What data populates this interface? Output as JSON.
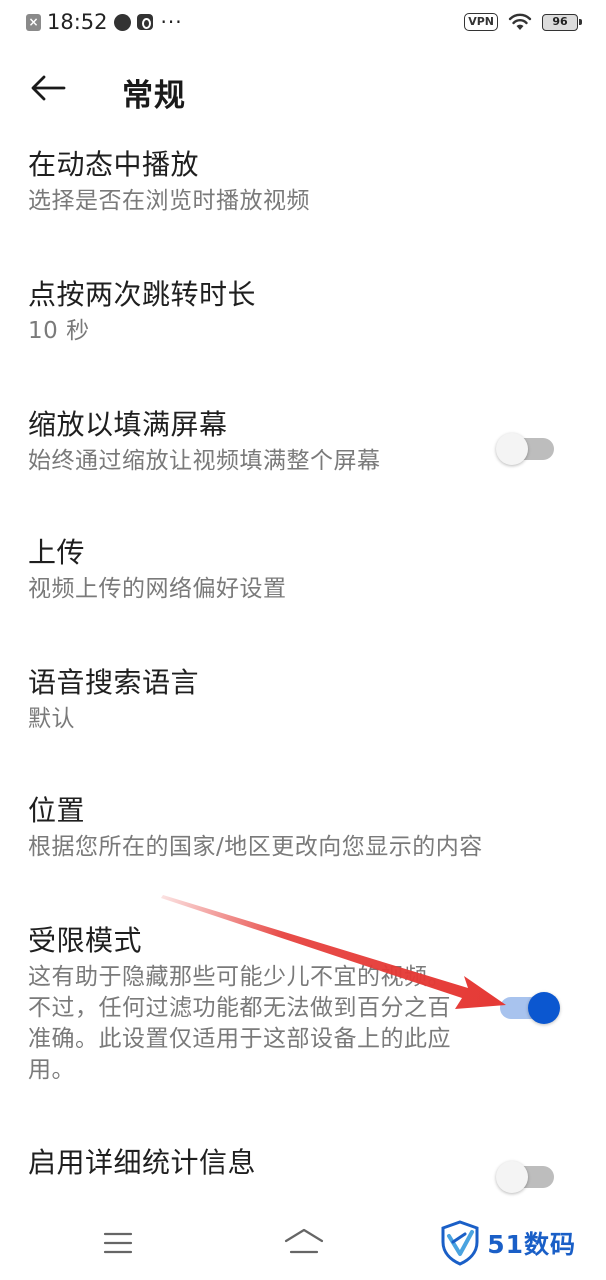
{
  "status_bar": {
    "time": "18:52",
    "more_indicator": "···",
    "vpn_label": "VPN",
    "battery_level": "96",
    "icons": [
      "notification-x-icon",
      "app-notification-icon",
      "app-notification-icon",
      "wifi-icon",
      "battery-icon"
    ]
  },
  "header": {
    "back_icon": "arrow-left-icon",
    "title": "常规"
  },
  "settings": [
    {
      "title": "在动态中播放",
      "subtitle": "选择是否在浏览时播放视频"
    },
    {
      "title": "点按两次跳转时长",
      "subtitle": "10 秒"
    },
    {
      "title": "缩放以填满屏幕",
      "subtitle": "始终通过缩放让视频填满整个屏幕",
      "toggle": false
    },
    {
      "title": "上传",
      "subtitle": "视频上传的网络偏好设置"
    },
    {
      "title": "语音搜索语言",
      "subtitle": "默认"
    },
    {
      "title": "位置",
      "subtitle": "根据您所在的国家/地区更改向您显示的内容"
    },
    {
      "title": "受限模式",
      "subtitle": "这有助于隐藏那些可能少儿不宜的视频。不过，任何过滤功能都无法做到百分之百准确。此设置仅适用于这部设备上的此应用。",
      "toggle": true
    },
    {
      "title": "启用详细统计信息",
      "toggle": false
    }
  ],
  "colors": {
    "toggle_on": "#0b57d0",
    "toggle_on_track": "#a8c3ee",
    "toggle_off_track": "#bdbdbd",
    "annotation_arrow": "#e53935",
    "watermark": "#1a5fc7"
  },
  "nav_bar": {
    "icons": [
      "menu-icon",
      "home-icon"
    ]
  },
  "watermark": {
    "text": "51数码"
  }
}
